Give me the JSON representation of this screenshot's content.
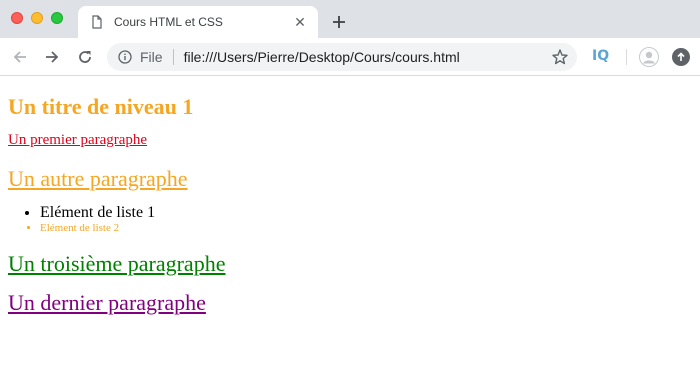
{
  "browser": {
    "tab": {
      "title": "Cours HTML et CSS",
      "close_glyph": "✕"
    },
    "newtab_glyph": "+",
    "omnibox": {
      "scheme_label": "File",
      "url": "file:///Users/Pierre/Desktop/Cours/cours.html"
    },
    "extension_label": "IQ",
    "icons": [
      "info-icon",
      "star-icon",
      "back-icon",
      "forward-icon",
      "reload-icon",
      "document-icon",
      "avatar-icon",
      "update-icon"
    ]
  },
  "page": {
    "heading": "Un titre de niveau 1",
    "paragraph_1": "Un premier paragraphe",
    "paragraph_2": "Un autre paragraphe",
    "list": [
      "Elément de liste 1",
      "Elément de liste 2"
    ],
    "paragraph_3": "Un troisième paragraphe",
    "paragraph_4": "Un dernier paragraphe"
  },
  "colors": {
    "orange": "#f5a623",
    "red": "#e0001b",
    "green": "#008000",
    "purple": "#800080"
  }
}
